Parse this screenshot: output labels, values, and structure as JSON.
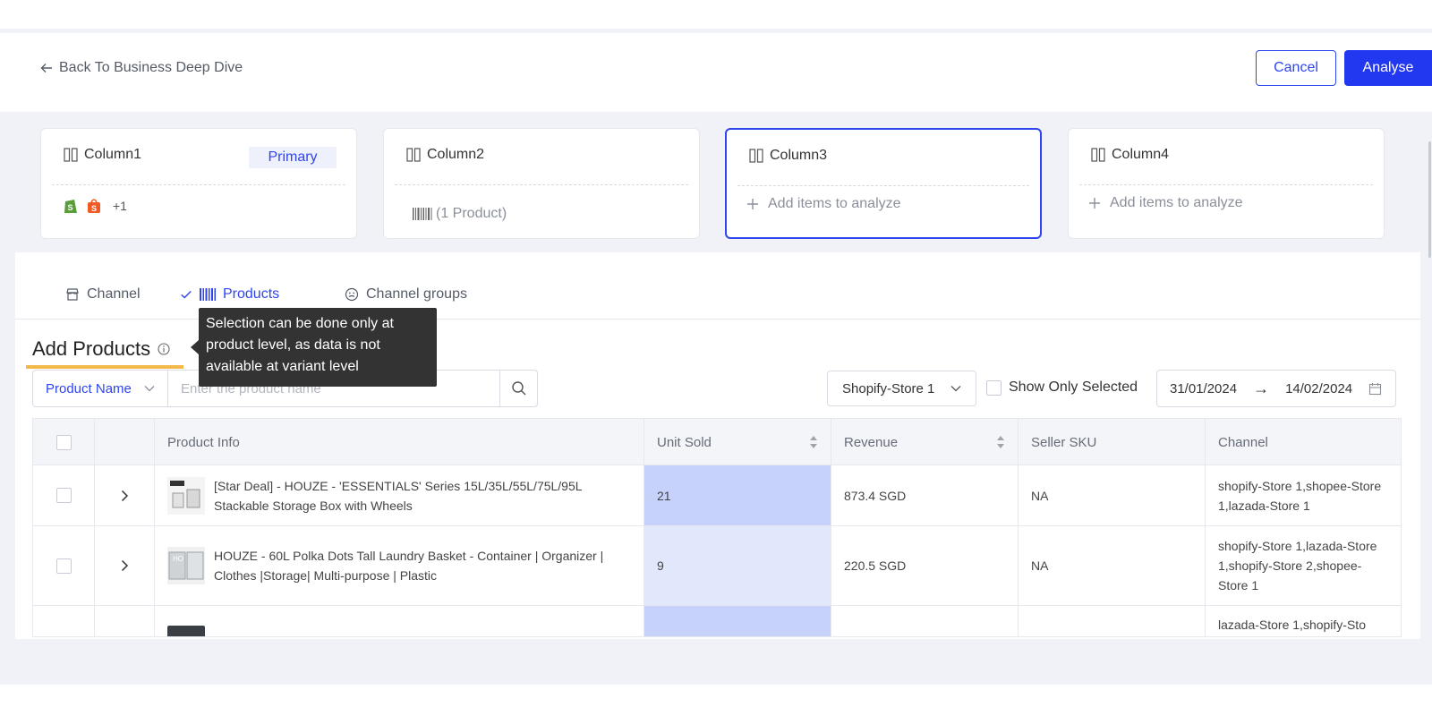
{
  "header": {
    "back_label": "Back To Business Deep Dive",
    "cancel_label": "Cancel",
    "analyse_label": "Analyse"
  },
  "columns": [
    {
      "title": "Column1",
      "badge": "Primary",
      "extra_count": "+1"
    },
    {
      "title": "Column2",
      "products_label": "(1 Product)"
    },
    {
      "title": "Column3",
      "add_label": "Add items to analyze"
    },
    {
      "title": "Column4",
      "add_label": "Add items to analyze"
    }
  ],
  "tabs": [
    {
      "label": "Channel",
      "icon": "store-icon"
    },
    {
      "label": "Products",
      "icon": "barcode-icon",
      "selected": true
    },
    {
      "label": "Channel groups",
      "icon": "smile-icon"
    }
  ],
  "section": {
    "title": "Add Products",
    "tooltip": "Selection can be done only at product level, as data is not available at variant level"
  },
  "filters": {
    "search_field": "Product Name",
    "search_placeholder": "Enter the product name",
    "store": "Shopify-Store 1",
    "show_only_selected": "Show Only Selected",
    "date_from": "31/01/2024",
    "date_arrow": "→",
    "date_to": "14/02/2024"
  },
  "table": {
    "headers": [
      "Product Info",
      "Unit Sold",
      "Revenue",
      "Seller SKU",
      "Channel"
    ],
    "rows": [
      {
        "product": "[Star Deal] - HOUZE - 'ESSENTIALS' Series 15L/35L/55L/75L/95L Stackable Storage Box with Wheels",
        "units": "21",
        "revenue": "873.4 SGD",
        "sku": "NA",
        "channel": "shopify-Store 1,shopee-Store 1,lazada-Store 1"
      },
      {
        "product": "HOUZE - 60L Polka Dots Tall Laundry Basket - Container | Organizer | Clothes |Storage| Multi-purpose | Plastic",
        "units": "9",
        "revenue": "220.5 SGD",
        "sku": "NA",
        "channel": "shopify-Store 1,lazada-Store 1,shopify-Store 2,shopee-Store 1"
      },
      {
        "product": "",
        "units": "",
        "revenue": "",
        "sku": "",
        "channel": "lazada-Store 1,shopify-Sto"
      }
    ]
  },
  "colors": {
    "accent": "#2f45f0",
    "underline": "#f2b94a",
    "tooltip_bg": "#333333",
    "unit_highlight_strong": "#c7d2fb",
    "unit_highlight_light": "#e2e8fc"
  }
}
